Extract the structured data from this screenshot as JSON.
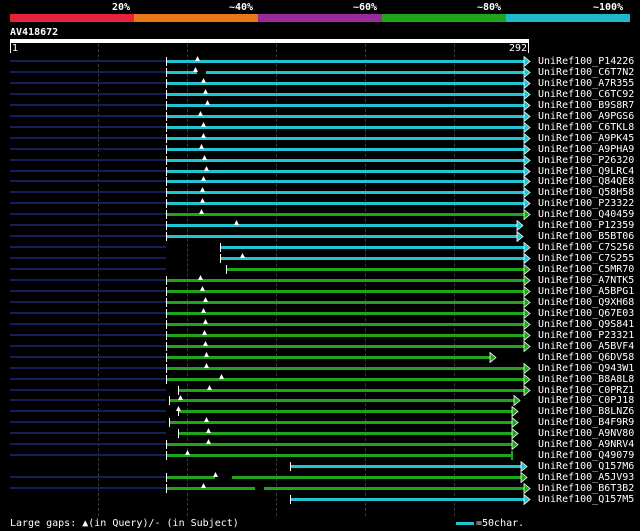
{
  "query": {
    "id": "AV418672",
    "start": "1",
    "end": "292"
  },
  "scale": {
    "labels": [
      "20%",
      "~40%",
      "~60%",
      "~80%",
      "~100%"
    ],
    "segments": [
      {
        "color": "#e8213a"
      },
      {
        "color": "#e67817"
      },
      {
        "color": "#9a2a9b"
      },
      {
        "color": "#1ea51a"
      },
      {
        "color": "#20b8c8"
      }
    ]
  },
  "colors": {
    "cyan": "#21c4d2",
    "green": "#1fa51b",
    "navy": "#151f55",
    "gap": "#000000"
  },
  "hits": [
    {
      "label": "UniRef100_P14226",
      "c": "cyan",
      "e": "arrow"
    },
    {
      "label": "UniRef100_C6T7N2",
      "c": "cyan",
      "e": "arrow"
    },
    {
      "label": "UniRef100_A7R355",
      "c": "cyan",
      "e": "arrow"
    },
    {
      "label": "UniRef100_C6TC92",
      "c": "cyan",
      "e": "arrow"
    },
    {
      "label": "UniRef100_B9S8R7",
      "c": "cyan",
      "e": "arrow"
    },
    {
      "label": "UniRef100_A9PGS6",
      "c": "cyan",
      "e": "arrow"
    },
    {
      "label": "UniRef100_C6TKL8",
      "c": "cyan",
      "e": "arrow"
    },
    {
      "label": "UniRef100_A9PK45",
      "c": "cyan",
      "e": "arrow"
    },
    {
      "label": "UniRef100_A9PHA9",
      "c": "cyan",
      "e": "arrow"
    },
    {
      "label": "UniRef100_P26320",
      "c": "cyan",
      "e": "arrow"
    },
    {
      "label": "UniRef100_Q9LRC4",
      "c": "cyan",
      "e": "arrow"
    },
    {
      "label": "UniRef100_Q84QE8",
      "c": "cyan",
      "e": "arrow"
    },
    {
      "label": "UniRef100_Q58H58",
      "c": "cyan",
      "e": "arrow"
    },
    {
      "label": "UniRef100_P23322",
      "c": "cyan",
      "e": "arrow"
    },
    {
      "label": "UniRef100_Q40459",
      "c": "green",
      "e": "arrow"
    },
    {
      "label": "UniRef100_P12359",
      "c": "cyan",
      "e": "arrow"
    },
    {
      "label": "UniRef100_B5BT06",
      "c": "cyan",
      "e": "arrow"
    },
    {
      "label": "UniRef100_C7S256",
      "c": "cyan",
      "e": "arrow"
    },
    {
      "label": "UniRef100_C7S255",
      "c": "cyan",
      "e": "arrow"
    },
    {
      "label": "UniRef100_C5MR70",
      "c": "green",
      "e": "arrow"
    },
    {
      "label": "UniRef100_A7NTK5",
      "c": "green",
      "e": "arrow"
    },
    {
      "label": "UniRef100_A5BPG1",
      "c": "green",
      "e": "arrow"
    },
    {
      "label": "UniRef100_Q9XH68",
      "c": "green",
      "e": "arrow"
    },
    {
      "label": "UniRef100_Q67E03",
      "c": "green",
      "e": "arrow"
    },
    {
      "label": "UniRef100_Q9S841",
      "c": "green",
      "e": "arrow"
    },
    {
      "label": "UniRef100_P23321",
      "c": "green",
      "e": "arrow"
    },
    {
      "label": "UniRef100_A5BVF4",
      "c": "green",
      "e": "arrow"
    },
    {
      "label": "UniRef100_Q6DV58",
      "c": "green",
      "e": "arrow"
    },
    {
      "label": "UniRef100_Q943W1",
      "c": "green",
      "e": "arrow"
    },
    {
      "label": "UniRef100_B8A8L8",
      "c": "green",
      "e": "arrow"
    },
    {
      "label": "UniRef100_C0PRZ1",
      "c": "green",
      "e": "arrow"
    },
    {
      "label": "UniRef100_C0PJ18",
      "c": "green",
      "e": "arrow"
    },
    {
      "label": "UniRef100_B8LNZ6",
      "c": "green",
      "e": "arrow"
    },
    {
      "label": "UniRef100_B4F9R9",
      "c": "green",
      "e": "arrow"
    },
    {
      "label": "UniRef100_A9NV80",
      "c": "green",
      "e": "arrow"
    },
    {
      "label": "UniRef100_A9NRV4",
      "c": "green",
      "e": "arrow"
    },
    {
      "label": "UniRef100_Q49079",
      "c": "green",
      "e": "bar"
    },
    {
      "label": "UniRef100_Q157M6",
      "c": "cyan",
      "e": "arrow"
    },
    {
      "label": "UniRef100_A5JV93",
      "c": "green",
      "e": "arrow"
    },
    {
      "label": "UniRef100_B6T3B2",
      "c": "green",
      "e": "arrow"
    },
    {
      "label": "UniRef100_Q157M5",
      "c": "cyan",
      "e": "arrow"
    }
  ],
  "footer": {
    "legend": "Large gaps: ▲(in Query)/- (in Subject)",
    "scale_note": "=50char."
  }
}
